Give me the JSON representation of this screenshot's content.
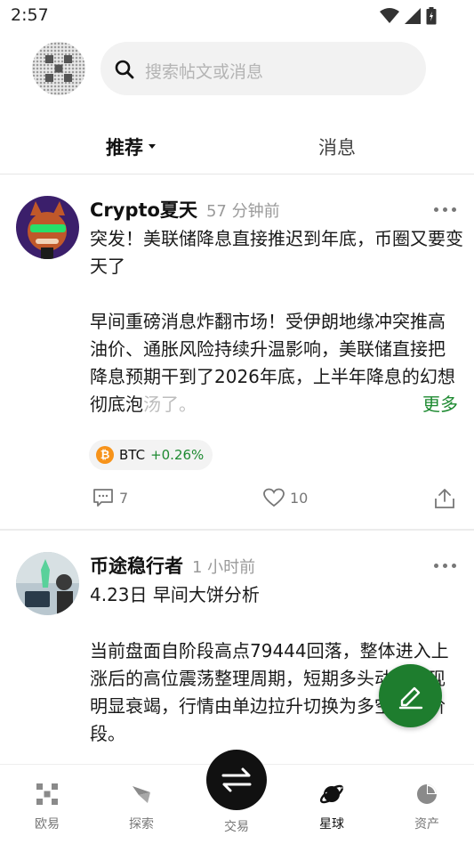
{
  "status_bar": {
    "time": "2:57"
  },
  "search": {
    "placeholder": "搜索帖文或消息"
  },
  "tabs": {
    "recommend": "推荐",
    "messages": "消息"
  },
  "posts": [
    {
      "author": "Crypto夏天",
      "time": "57 分钟前",
      "title": "突发！美联储降息直接推迟到年底，币圈又要变天了",
      "body": "早间重磅消息炸翻市场！受伊朗地缘冲突推高油价、通胀风险持续升温影响，美联储直接把降息预期干到了2026年底，上半年降息的幻想彻底泡",
      "body_faded": "汤了。",
      "more": "更多",
      "tag": {
        "symbol": "BTC",
        "change": "+0.26%",
        "icon": "bitcoin-icon",
        "icon_glyph": "₿"
      },
      "comments": "7",
      "likes": "10"
    },
    {
      "author": "币途稳行者",
      "time": "1 小时前",
      "title": "4.23日 早间大饼分析",
      "body": "当前盘面自阶段高点79444回落，整体进入上涨后的高位震荡整理周期，短期多头动量出现明显衰竭，行情由单边拉升切换为多空博弈阶段。"
    }
  ],
  "bottom_nav": {
    "home": "欧易",
    "discover": "探索",
    "trade": "交易",
    "planet": "星球",
    "assets": "资产"
  },
  "colors": {
    "accent_green": "#1e7d2e",
    "positive": "#1e8a31",
    "btc_orange": "#f7931a"
  }
}
